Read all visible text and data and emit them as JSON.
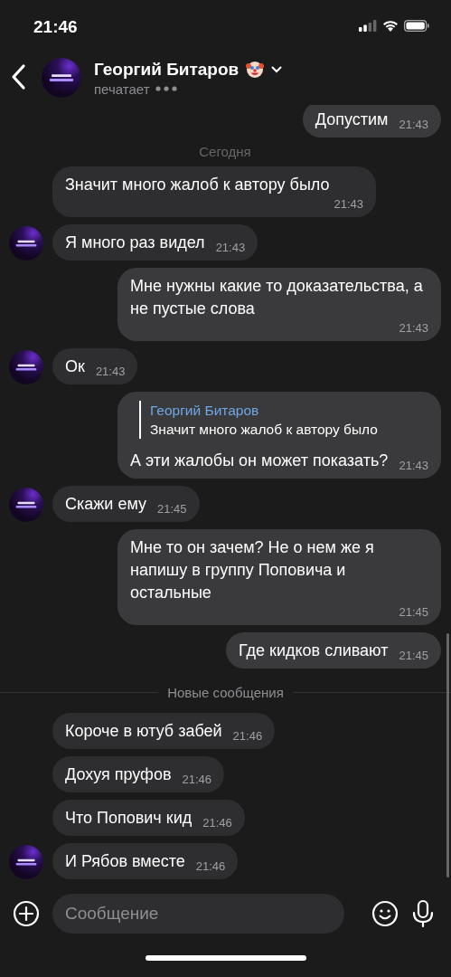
{
  "status_bar": {
    "time": "21:46"
  },
  "header": {
    "name": "Георгий Битаров",
    "status": "печатает"
  },
  "messages": [
    {
      "kind": "outgoing",
      "text": "Допустим",
      "time": "21:43"
    },
    {
      "kind": "date",
      "text": "Сегодня"
    },
    {
      "kind": "incoming",
      "text": "Значит много жалоб к автору было",
      "time": "21:43",
      "avatar": false
    },
    {
      "kind": "incoming",
      "text": "Я много раз видел",
      "time": "21:43",
      "avatar": true
    },
    {
      "kind": "outgoing",
      "text": "Мне нужны какие то доказательства, а не пустые слова",
      "time": "21:43"
    },
    {
      "kind": "incoming",
      "text": "Ок",
      "time": "21:43",
      "avatar": true
    },
    {
      "kind": "outgoing",
      "text": "А эти жалобы он может показать?",
      "time": "21:43",
      "reply": {
        "author": "Георгий Битаров",
        "text": "Значит много жалоб к автору было"
      }
    },
    {
      "kind": "incoming",
      "text": "Скажи ему",
      "time": "21:45",
      "avatar": true
    },
    {
      "kind": "outgoing",
      "text": "Мне то он зачем? Не о нем же я напишу в группу Поповича и остальные",
      "time": "21:45"
    },
    {
      "kind": "outgoing",
      "text": "Где кидков сливают",
      "time": "21:45"
    },
    {
      "kind": "divider",
      "text": "Новые сообщения"
    },
    {
      "kind": "incoming",
      "text": "Короче в ютуб забей",
      "time": "21:46",
      "avatar": false
    },
    {
      "kind": "incoming",
      "text": "Дохуя пруфов",
      "time": "21:46",
      "avatar": false
    },
    {
      "kind": "incoming",
      "text": "Что Попович кид",
      "time": "21:46",
      "avatar": false
    },
    {
      "kind": "incoming",
      "text": "И Рябов вместе",
      "time": "21:46",
      "avatar": true
    }
  ],
  "composer": {
    "placeholder": "Сообщение"
  }
}
